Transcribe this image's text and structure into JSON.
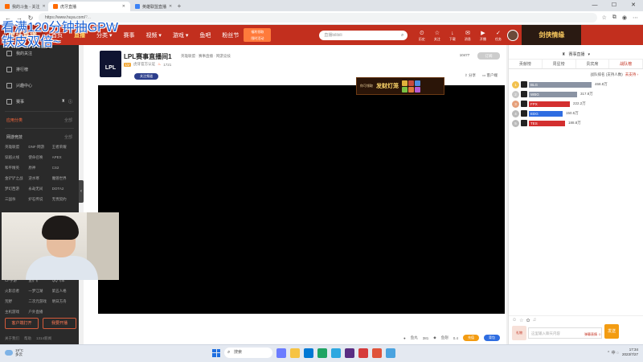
{
  "browser": {
    "tabs": [
      {
        "label": "我的斗鱼 - 关注"
      },
      {
        "label": "虎牙直播"
      },
      {
        "label": "英雄联盟直播"
      }
    ],
    "url": "https://www.huya.com/",
    "url_query": "?...",
    "window_controls": [
      "—",
      "☐",
      "✕"
    ]
  },
  "overlay": {
    "line1": "看满120分钟抽GPW",
    "line2": "铁皮双倍~"
  },
  "header": {
    "logo": "虎牙直播",
    "nav": [
      {
        "label": "首页"
      },
      {
        "label": "直播",
        "active": true
      },
      {
        "label": "分类 ▾"
      },
      {
        "label": "赛事"
      },
      {
        "label": "视频 ▾"
      },
      {
        "label": "游戏 ▾"
      },
      {
        "label": "鱼吧"
      },
      {
        "label": "粉丝节"
      }
    ],
    "promo_line1": "福利领取",
    "promo_line2": "限时活动",
    "search_placeholder": "直播bilibili",
    "icons": [
      {
        "label": "历史",
        "glyph": "⏲"
      },
      {
        "label": "关注",
        "glyph": "☆"
      },
      {
        "label": "下载",
        "glyph": "↓"
      },
      {
        "label": "消息",
        "glyph": "✉"
      },
      {
        "label": "开播",
        "glyph": "▶"
      },
      {
        "label": "任务",
        "glyph": "✓"
      }
    ],
    "ad": "剑侠情缘"
  },
  "sidebar": {
    "items": [
      {
        "label": "我的关注"
      },
      {
        "label": "排行榜"
      },
      {
        "label": "兴趣中心"
      }
    ],
    "eco_label": "赛事",
    "section1": {
      "title": "应用分类",
      "more": "全部"
    },
    "section2": {
      "title": "网游竞技",
      "more": "全部"
    },
    "categories": [
      "英雄联盟",
      "DNF·网游",
      "王者荣耀",
      "穿越火线",
      "使命召唤",
      "APEX",
      "和平精英",
      "原神",
      "CS2",
      "金铲铲之战",
      "逆水寒",
      "魔兽世界",
      "梦幻西游",
      "永劫无间",
      "DOTA2",
      "三国杀",
      "炉石传说",
      "无畏契约"
    ],
    "categories2": [
      "CF手游",
      "金铲铲",
      "QQ飞车",
      "火影忍者",
      "一梦江湖",
      "第五人格",
      "荒野",
      "二次元游戏",
      "明日方舟",
      "主机游戏",
      "户外直播",
      ""
    ],
    "btn_client": "客户端打开",
    "btn_record": "我要开播",
    "footer": [
      "关于我们",
      "帮助",
      "1314新闻"
    ]
  },
  "stream": {
    "room_name": "LPL赛事直播间1",
    "category": "英雄联盟 · 赛事直播 · 网游竞技",
    "level": "LV",
    "tag": "虎牙官方认证",
    "hot": "1721",
    "follow_button": "关注频道",
    "viewer_count": "10477",
    "subscribe_button": "订阅",
    "actions": [
      "分享",
      "客户端"
    ],
    "logo_text": "LPL"
  },
  "banner": {
    "small": "你可领取",
    "big": "发财灯笼"
  },
  "gift_bar": {
    "fish_label": "鱼丸",
    "fish_value": "381",
    "bean_label": "鱼翅",
    "bean_value": "0.4",
    "btn_recharge": "充值",
    "btn_bag": "背包"
  },
  "right_panel": {
    "top_label": "赛事直播",
    "tabs": [
      {
        "label": "贡献榜"
      },
      {
        "label": "周星榜"
      },
      {
        "label": "贵宾席"
      },
      {
        "label": "战队榜",
        "active": true
      }
    ],
    "subtitle": "战队排名 (支持人数)",
    "link": "去支持 ›",
    "ranking": [
      {
        "rank": "1",
        "team": "BLG",
        "value": "468.8万",
        "pct": 0.64,
        "color": "#8a93a3",
        "medal": "#f2c14e"
      },
      {
        "rank": "2",
        "team": "WBG",
        "value": "317.8万",
        "pct": 0.44,
        "color": "#8a93a3",
        "medal": "#c7c7c7"
      },
      {
        "rank": "3",
        "team": "FPX",
        "value": "222.2万",
        "pct": 0.34,
        "color": "#d32f2f",
        "medal": "#e6a07b"
      },
      {
        "rank": "4",
        "team": "EDG",
        "value": "150.5万",
        "pct": 0.24,
        "color": "#2f6de1",
        "medal": "#bbbbbb"
      },
      {
        "rank": "5",
        "team": "TES",
        "value": "188.8万",
        "pct": 0.28,
        "color": "#d32f2f",
        "medal": "#bbbbbb"
      }
    ],
    "input_placeholder": "这里输入聊天内容",
    "emoji_label": "弹幕表情 ☺",
    "send": "发送",
    "gift_label": "礼物"
  },
  "taskbar": {
    "temp": "19°C",
    "weather": "多云",
    "search": "搜索",
    "apps": [
      {
        "color": "#6b7cff"
      },
      {
        "color": "#f6c343"
      },
      {
        "color": "#0078d4"
      },
      {
        "color": "#1fa463"
      },
      {
        "color": "#2ea8e0"
      },
      {
        "color": "#5a2d82"
      },
      {
        "color": "#d63b3b"
      },
      {
        "color": "#e0533a"
      },
      {
        "color": "#4aa3df"
      }
    ],
    "tray": "⌃ 中 ◌",
    "time": "17:34",
    "date": "2023/7/27"
  }
}
